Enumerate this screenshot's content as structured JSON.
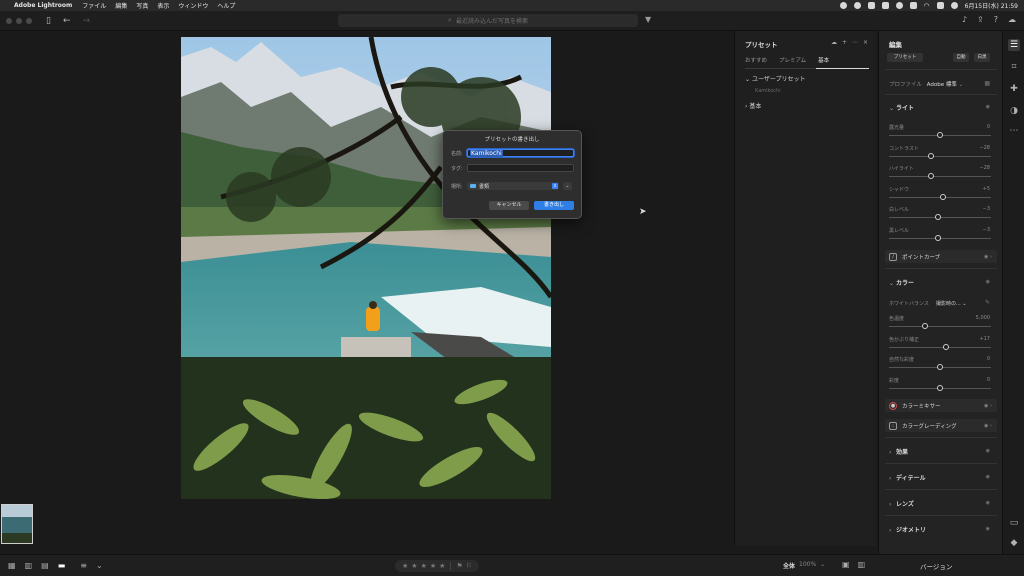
{
  "menubar": {
    "app_name": "Adobe Lightroom",
    "menus": [
      "ファイル",
      "編集",
      "写真",
      "表示",
      "ウィンドウ",
      "ヘルプ"
    ],
    "datetime": "6月15日(水) 21:59"
  },
  "toolbar": {
    "search_placeholder": "最近読み込んだ写真を検索"
  },
  "dialog": {
    "title": "プリセットの書き出し",
    "name_label": "名前:",
    "name_value": "Kamikochi",
    "tag_label": "タグ:",
    "tag_value": "",
    "location_label": "場所:",
    "location_value": "書類",
    "cancel_label": "キャンセル",
    "export_label": "書き出し"
  },
  "preset_panel": {
    "title": "プリセット",
    "tabs": [
      "おすすめ",
      "プレミアム",
      "基本"
    ],
    "active_tab": "基本",
    "groups": [
      {
        "label": "ユーザープリセット",
        "expanded": true,
        "items": [
          "Kamikochi"
        ]
      },
      {
        "label": "基本",
        "expanded": false,
        "items": []
      }
    ]
  },
  "edit_panel": {
    "title": "編集",
    "preset_button": "プリセット",
    "auto_button": "自動",
    "bw_button": "白黒",
    "profile_label": "プロファイル",
    "profile_value": "Adobe 標準",
    "light": {
      "title": "ライト",
      "sliders": [
        {
          "label": "露光量",
          "value": "0",
          "position": 0.5
        },
        {
          "label": "コントラスト",
          "value": "−28",
          "position": 0.41
        },
        {
          "label": "ハイライト",
          "value": "−28",
          "position": 0.41
        },
        {
          "label": "シャドウ",
          "value": "+5",
          "position": 0.53
        },
        {
          "label": "白レベル",
          "value": "−3",
          "position": 0.48
        },
        {
          "label": "黒レベル",
          "value": "−3",
          "position": 0.48
        }
      ]
    },
    "point_curve": "ポイントカーブ",
    "color": {
      "title": "カラー",
      "wb_label": "ホワイトバランス",
      "wb_value": "撮影時の...",
      "sliders": [
        {
          "label": "色温度",
          "value": "5,000",
          "position": 0.35
        },
        {
          "label": "色かぶり補正",
          "value": "+17",
          "position": 0.56
        },
        {
          "label": "自然な彩度",
          "value": "0",
          "position": 0.5
        },
        {
          "label": "彩度",
          "value": "0",
          "position": 0.5
        }
      ]
    },
    "color_mixer": "カラーミキサー",
    "color_grading": "カラーグレーディング",
    "sections": [
      "効果",
      "ディテール",
      "レンズ",
      "ジオメトリ"
    ]
  },
  "bottom": {
    "zoom_label": "全体",
    "zoom_pct": "100%",
    "version_label": "バージョン"
  }
}
